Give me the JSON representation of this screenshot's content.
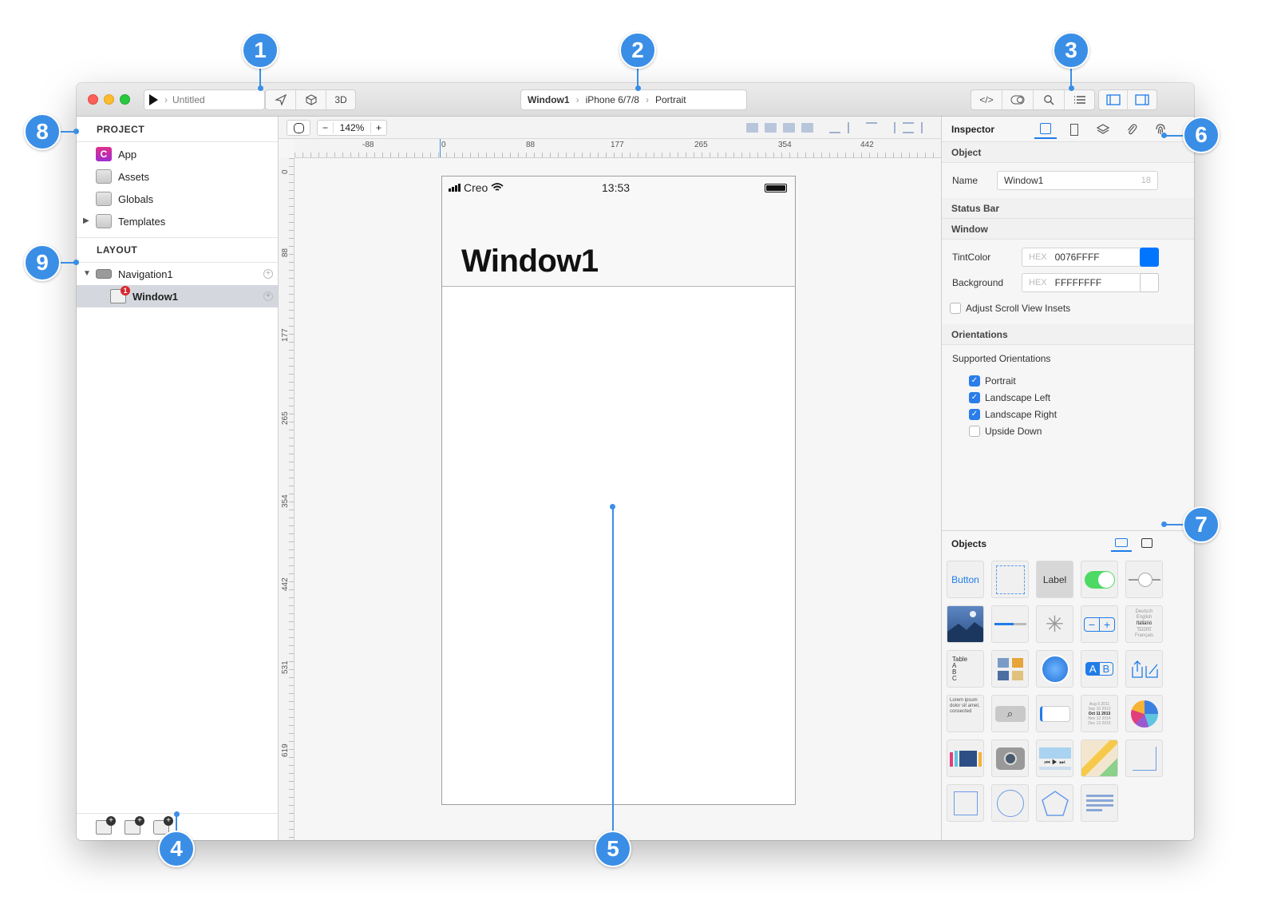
{
  "window": {
    "run_target": "Untitled",
    "view_3d_label": "3D",
    "breadcrumb": {
      "window": "Window1",
      "device": "iPhone 6/7/8",
      "orientation": "Portrait"
    }
  },
  "project": {
    "heading": "PROJECT",
    "items": [
      {
        "label": "App",
        "icon": "app-icon"
      },
      {
        "label": "Assets",
        "icon": "folder-icon"
      },
      {
        "label": "Globals",
        "icon": "folder-icon"
      },
      {
        "label": "Templates",
        "icon": "folder-icon"
      }
    ]
  },
  "layout": {
    "heading": "LAYOUT",
    "items": [
      {
        "label": "Navigation1"
      },
      {
        "label": "Window1",
        "badge": "1"
      }
    ]
  },
  "canvas": {
    "zoom": "142%",
    "hruler_labels": [
      "-88",
      "0",
      "88",
      "177",
      "265",
      "354",
      "442"
    ],
    "vruler_labels": [
      "0",
      "88",
      "177",
      "265",
      "354",
      "442",
      "531",
      "619"
    ]
  },
  "device": {
    "carrier": "Creo",
    "time": "13:53",
    "title": "Window1"
  },
  "inspector": {
    "title": "Inspector",
    "object_section": "Object",
    "name_label": "Name",
    "name_value": "Window1",
    "name_count": "18",
    "status_bar_section": "Status Bar",
    "window_section": "Window",
    "tint_label": "TintColor",
    "hex_tag": "HEX",
    "tint_value": "0076FFFF",
    "tint_color": "#0076FF",
    "background_label": "Background",
    "background_value": "FFFFFFFF",
    "background_color": "#FFFFFF",
    "adjust_insets_label": "Adjust Scroll View Insets",
    "orientations_section": "Orientations",
    "supported_label": "Supported Orientations",
    "orientations": [
      {
        "label": "Portrait",
        "checked": true
      },
      {
        "label": "Landscape Left",
        "checked": true
      },
      {
        "label": "Landscape Right",
        "checked": true
      },
      {
        "label": "Upside Down",
        "checked": false
      }
    ]
  },
  "objects": {
    "title": "Objects",
    "button_label": "Button",
    "label_label": "Label",
    "table_label": "Table",
    "table_rows": [
      "A",
      "B",
      "C"
    ],
    "picker_rows": [
      "Deutsch",
      "English",
      "Italiano",
      "Suomi",
      "Français"
    ],
    "segmented": [
      "A",
      "B"
    ],
    "lorem": "Lorem ipsum dolor sit amet, consected",
    "dates": [
      "Aug 9 2011",
      "Sep 10 2012",
      "Oct 11 2013",
      "Nov 12 2014",
      "Dec 13 2015"
    ]
  },
  "callouts": [
    "1",
    "2",
    "3",
    "4",
    "5",
    "6",
    "7",
    "8",
    "9"
  ],
  "colors": {
    "accent": "#3A8EE6",
    "selection": "#D4D8DE"
  }
}
